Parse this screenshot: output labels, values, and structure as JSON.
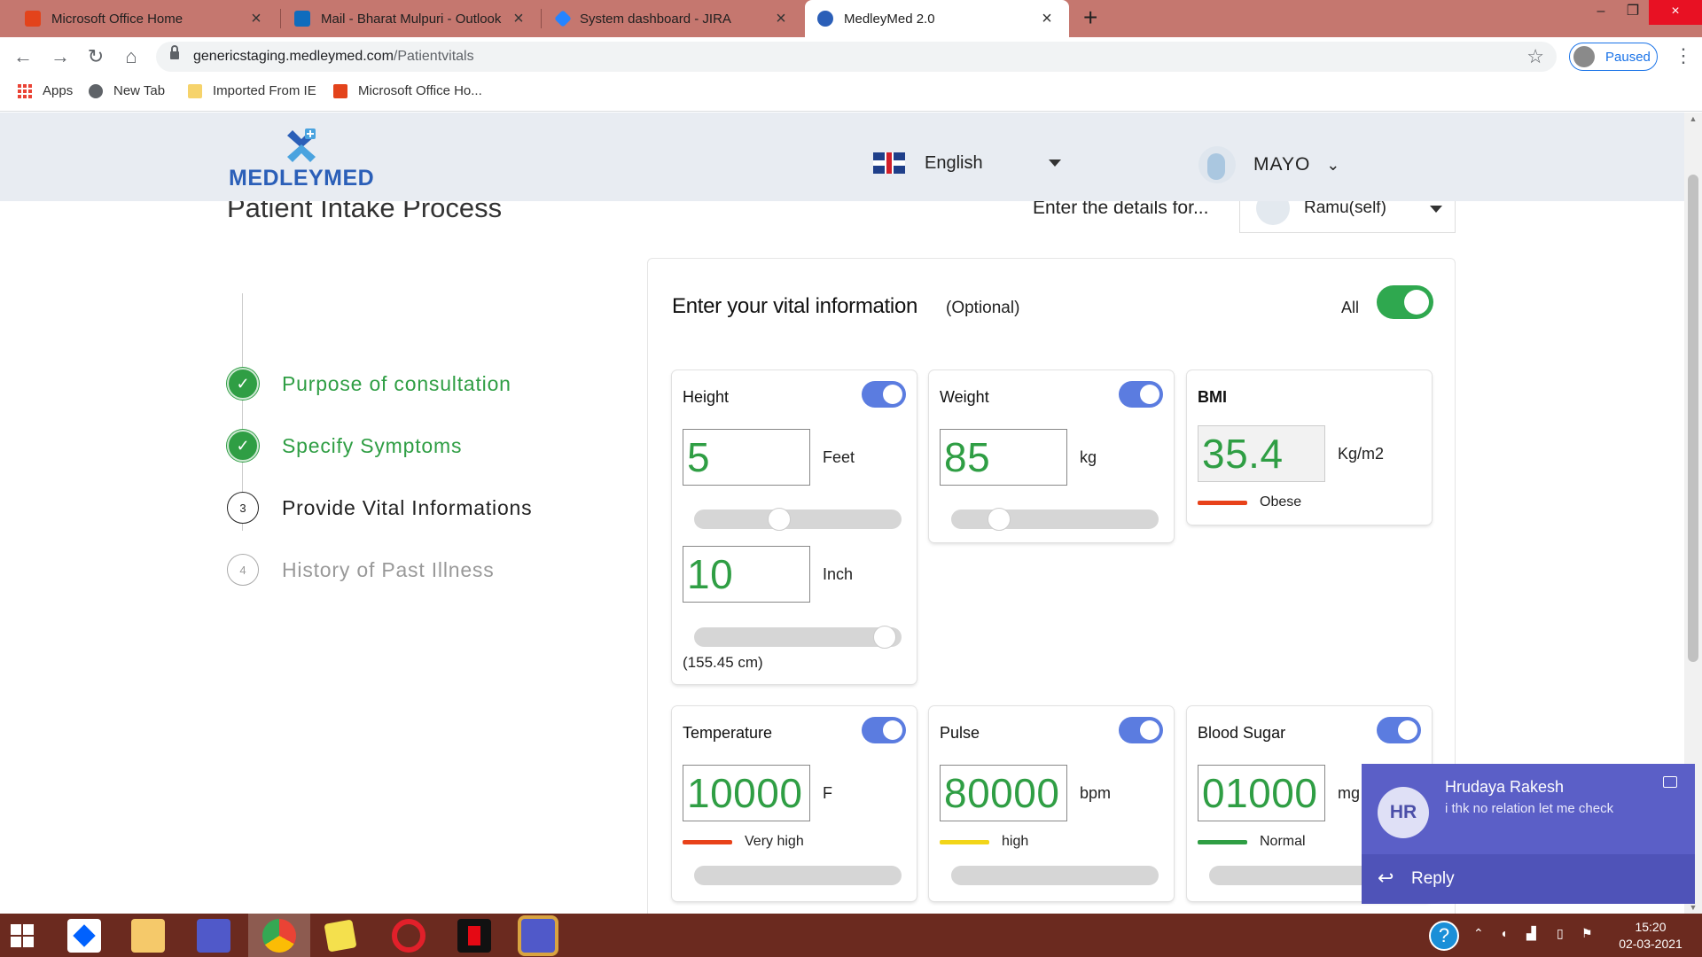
{
  "browser": {
    "tabs": [
      {
        "title": "Microsoft Office Home",
        "favicon_color": "#e3431b"
      },
      {
        "title": "Mail - Bharat Mulpuri - Outlook",
        "favicon_color": "#0f6cbd"
      },
      {
        "title": "System dashboard - JIRA",
        "favicon_color": "#2684ff"
      },
      {
        "title": "MedleyMed 2.0",
        "favicon_color": "#2b5fb8"
      }
    ],
    "url_host": "genericstaging.medleymed.com",
    "url_path": "/Patientvitals",
    "profile_status": "Paused",
    "bookmarks": [
      "Apps",
      "New Tab",
      "Imported From IE",
      "Microsoft Office Ho..."
    ]
  },
  "header": {
    "logo_text": "MEDLEYMED",
    "language": "English",
    "user": "MAYO"
  },
  "page": {
    "title": "Patient Intake Process",
    "enter_for_label": "Enter the details for...",
    "patient": "Ramu(self)"
  },
  "steps": [
    {
      "number": "1",
      "label": "Purpose of consultation",
      "state": "done"
    },
    {
      "number": "2",
      "label": "Specify Symptoms",
      "state": "done"
    },
    {
      "number": "3",
      "label": "Provide Vital Informations",
      "state": "current"
    },
    {
      "number": "4",
      "label": "History of Past Illness",
      "state": "todo"
    }
  ],
  "vitals": {
    "title": "Enter your vital information",
    "optional": "(Optional)",
    "all_label": "All",
    "height": {
      "label": "Height",
      "feet": "5",
      "feet_unit": "Feet",
      "inch": "10",
      "inch_unit": "Inch",
      "cm": "(155.45 cm)",
      "feet_slider": 0.41,
      "inch_slider": 0.92
    },
    "weight": {
      "label": "Weight",
      "value": "85",
      "unit": "kg",
      "slider": 0.23
    },
    "bmi": {
      "label": "BMI",
      "value": "35.4",
      "unit": "Kg/m2",
      "status": "Obese",
      "status_color": "#e8421a"
    },
    "temperature": {
      "label": "Temperature",
      "value": "10000",
      "unit": "F",
      "status": "Very high",
      "status_color": "#e8421a"
    },
    "pulse": {
      "label": "Pulse",
      "value": "80000",
      "unit": "bpm",
      "status": "high",
      "status_color": "#f2d518"
    },
    "sugar": {
      "label": "Blood Sugar",
      "value": "01000",
      "unit": "mg",
      "status": "Normal",
      "status_color": "#2f9e44"
    }
  },
  "notification": {
    "initials": "HR",
    "sender": "Hrudaya Rakesh",
    "message": "i thk no relation let me check",
    "reply_label": "Reply"
  },
  "taskbar": {
    "time": "15:20",
    "date": "02-03-2021"
  }
}
